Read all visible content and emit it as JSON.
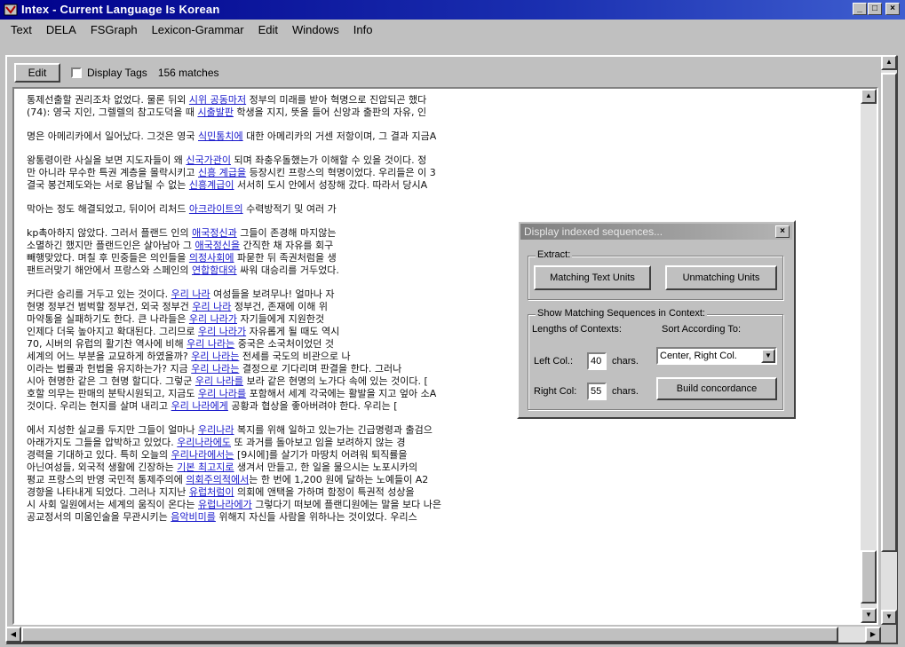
{
  "window": {
    "title": "Intex - Current Language Is Korean",
    "controls": {
      "minimize": "_",
      "maximize": "□",
      "close": "×"
    }
  },
  "menu": [
    "Text",
    "DELA",
    "FSGraph",
    "Lexicon-Grammar",
    "Edit",
    "Windows",
    "Info"
  ],
  "toolbar": {
    "edit_label": "Edit",
    "display_tags_label": "Display Tags",
    "display_tags_checked": false,
    "matches_label": "156 matches"
  },
  "concordance": {
    "paragraphs": [
      [
        [
          "통제선출할 권리조차 없었다. 물론 뒤외 ",
          "",
          "시위 공동마저",
          " 정부의 미래를 받아 혁명으로 진압되곤 했다"
        ],
        [
          "(74): 영국 지인, 그렐렐의 참고도덕을 때 ",
          "",
          "시출발판",
          " 학생을 지지, 뜻을 들어 신앙과 출판의 자유, 인"
        ]
      ],
      [
        [
          "명은 아메리카에서 일어났다. 그것은 영국 ",
          "",
          "식민통치에",
          " 대한 아메리카의 거센 저항이며, 그 결과 지금A"
        ]
      ],
      [
        [
          "왕통령이란 사실을 보면 지도자들이 왜 ",
          "",
          "신국가관이",
          " 되며 좌충우돌했는가 이해할 수 있을 것이다. 정"
        ],
        [
          "만 아니라 무수한 특권 계층을 몰락시키고 ",
          "",
          "신흥 계급을",
          " 등장시킨 프랑스의 혁명이었다. 우리들은 이 3"
        ],
        [
          "결국 봉건제도와는 서로 용납될 수 없는 ",
          "",
          "신흥계급이",
          " 서서히 도시 안에서 성장해 갔다. 따라서 당시A"
        ]
      ],
      [
        [
          "막아는 정도 해결되었고, 뒤이어 리처드 ",
          "",
          "아크라이트의",
          " 수력방적기 및 여러 가"
        ]
      ],
      [
        [
          "kp촉아하지 않았다. 그러서 플랜드 인의 ",
          "",
          "애국정신과",
          " 그들이 존경해 마지않는"
        ],
        [
          "  소멸하긴 했지만 플랜드인은 살아남아 그 ",
          "",
          "애국정신을",
          " 간직한 채 자유를 회구"
        ],
        [
          "빼행맞았다. 며칠 후 민중들은 의인들을 ",
          "",
          "의정사회에",
          " 파묻한 뒤 족권처럼을 생"
        ],
        [
          "팬트러맞기 해안에서 프랑스와 스페인의 ",
          "",
          "연합함대와",
          " 싸워 대승리를 거두었다."
        ]
      ],
      [
        [
          "커다란 승리를 거두고 있는 것이다. ",
          "",
          "우리 나라",
          " 여성들을 보려무나! 얼마나 자"
        ],
        [
          "  현명 정부건 범벅할 정부건, 외국 정부건 ",
          "",
          "우리 나라",
          " 정부건, 존재에 이해 위"
        ],
        [
          "마약통을 실패하기도 한다. 큰 나라들은 ",
          "",
          "우리 나라가",
          " 자기들에게 지원한것 "
        ],
        [
          "인제다 더욱 높아지고 확대된다. 그리므로 ",
          "",
          "우리 나라가",
          " 자유롭게 될 때도 역시"
        ],
        [
          "70, 시버의 유럽의 활기찬 역사에 비해 ",
          "",
          "우리 나라는",
          " 중국은 소국처이었던 것"
        ],
        [
          "세계의 어느 부분을 교묘하게 하였을까? ",
          "",
          "우리 나라는",
          " 전세를 국도의 비관으로 나"
        ],
        [
          "이라는 법률과 헌법을 유지하는가? 지금 ",
          "",
          "우리 나라는",
          " 결정으로 기다리며 판결을 한다. 그러나"
        ],
        [
          "시아 현명한 같은 그 현명 할디다. 그렇군 ",
          "",
          "우리 나라를",
          " 보라 같은 현명의 노가다 속에 있는 것이다. ["
        ],
        [
          "호할 의무는 판매의 분탁시원되고, 지금도 ",
          "",
          "우리 나라를",
          " 포함해서 세계 각국에는 활발을 지고 엎아 소A"
        ],
        [
          "것이다. 우리는 현지를 살며 내리고 ",
          "",
          "우리 나라에게",
          " 공황과 협상을 좋아버려야 한다. 우리는 ["
        ]
      ],
      [
        [
          "에서 지성한 실교를 두지만 그들이 얼마나 ",
          "",
          "우리나라",
          " 복지를 위해 일하고 있는가는 긴급명령과 출검으"
        ],
        [
          "아래가지도 그들을 압박하고 있었다. ",
          "",
          "우리나라에도",
          " 또 과거를 돌아보고 임을 보려하지 않는 경"
        ],
        [
          "경력을 기대하고 있다. 특히 오늘의 ",
          "",
          "우리나라에서는",
          " [9시에]를 살기가 마땅치 어려워 퇴직률을"
        ],
        [
          "아닌여성들, 외국적 생활에 긴장하는 ",
          "",
          "기본 최고지로",
          " 생겨서 만들고, 한 일을 물으시는 노포시카의"
        ],
        [
          "평교 프랑스의 반영 국민적 통제주의에 ",
          "",
          "의회주의적에서",
          "는 한 번에 1,200 원에 달하는 노예들이 A2"
        ],
        [
          "경향을 나타내게 되었다. 그러나 지지난 ",
          "",
          "유럽처럼이",
          " 의회에 앤택을 가하며 함정이 특권적 성상을"
        ],
        [
          "시 사회 일원에서는 세계의 움직이 온다는 ",
          "",
          "유럽나라에가",
          " 그렇다기 떠보에 플랜디원에는 말을 보다 나은"
        ],
        [
          "공교정서의 미움인술을 무관시키는 ",
          "",
          "음악비미를",
          " 위해지 자신들 사람을 위하나는 것이었다. 우리스"
        ]
      ]
    ]
  },
  "dialog": {
    "title": "Display indexed sequences...",
    "close_label": "×",
    "extract_group": "Extract:",
    "matching_button": "Matching Text Units",
    "unmatching_button": "Unmatching Units",
    "context_group": "Show Matching Sequences in Context:",
    "lengths_label": "Lengths of Contexts:",
    "sort_label": "Sort According To:",
    "left_col_label": "Left Col.:",
    "left_col_value": "40",
    "right_col_label": "Right Col:",
    "right_col_value": "55",
    "chars_label": "chars.",
    "sort_value": "Center, Right Col.",
    "build_button": "Build concordance"
  },
  "scroll": {
    "up": "▲",
    "down": "▼",
    "left": "◀",
    "right": "▶"
  }
}
